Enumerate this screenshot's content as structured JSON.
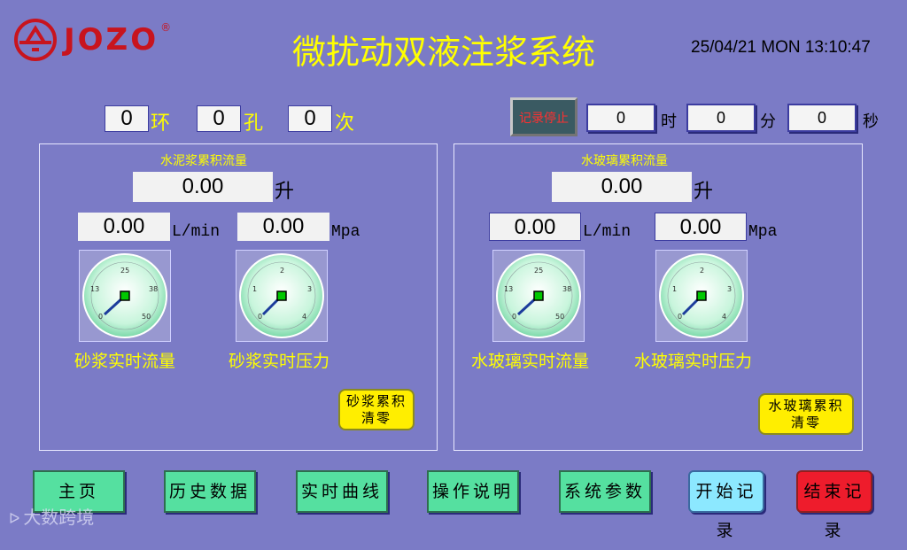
{
  "brand": {
    "name": "JOZO",
    "reg": "®"
  },
  "header": {
    "title": "微扰动双液注浆系统",
    "datetime": "25/04/21 MON 13:10:47"
  },
  "counters": [
    {
      "value": "0",
      "unit": "环"
    },
    {
      "value": "0",
      "unit": "孔"
    },
    {
      "value": "0",
      "unit": "次"
    }
  ],
  "recording": {
    "status_label": "记录停止"
  },
  "timer": [
    {
      "value": "0",
      "unit": "时"
    },
    {
      "value": "0",
      "unit": "分"
    },
    {
      "value": "0",
      "unit": "秒"
    }
  ],
  "left_panel": {
    "title": "水泥浆累积流量",
    "total": "0.00",
    "total_unit": "升",
    "flow": "0.00",
    "flow_unit": "L/min",
    "pressure": "0.00",
    "pressure_unit": "Mpa",
    "flow_gauge_label": "砂浆实时流量",
    "pressure_gauge_label": "砂浆实时压力",
    "reset_label_1": "砂浆累积",
    "reset_label_2": "清零"
  },
  "right_panel": {
    "title": "水玻璃累积流量",
    "total": "0.00",
    "total_unit": "升",
    "flow": "0.00",
    "flow_unit": "L/min",
    "pressure": "0.00",
    "pressure_unit": "Mpa",
    "flow_gauge_label": "水玻璃实时流量",
    "pressure_gauge_label": "水玻璃实时压力",
    "reset_label_1": "水玻璃累积",
    "reset_label_2": "清零"
  },
  "flow_gauge_ticks": [
    "0",
    "13",
    "25",
    "38",
    "50"
  ],
  "pressure_gauge_ticks": [
    "0",
    "1",
    "2",
    "3",
    "4"
  ],
  "nav": [
    {
      "label": "主页",
      "color": "#55e0a0"
    },
    {
      "label": "历史数据",
      "color": "#55e0a0"
    },
    {
      "label": "实时曲线",
      "color": "#55e0a0"
    },
    {
      "label": "操作说明",
      "color": "#55e0a0"
    },
    {
      "label": "系统参数",
      "color": "#55e0a0"
    },
    {
      "label": "开始记录",
      "color": "#8ce8ff"
    },
    {
      "label": "结束记录",
      "color": "#ee1c2c"
    }
  ],
  "watermark": "大数跨境"
}
